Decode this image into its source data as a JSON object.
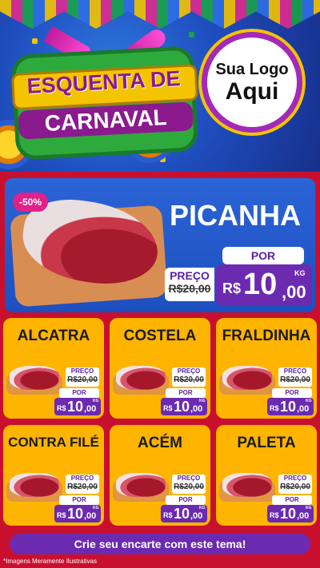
{
  "header": {
    "title_line1": "ESQUENTA DE",
    "title_line2": "CARNAVAL",
    "logo_line1": "Sua Logo",
    "logo_line2": "Aqui"
  },
  "featured": {
    "discount": "-50%",
    "name": "PICANHA",
    "preco_label": "PREÇO",
    "old_price": "R$20,00",
    "por_label": "POR",
    "currency": "R$",
    "price_int": "10",
    "price_cents": ",00",
    "unit": "KG"
  },
  "products": [
    {
      "name": "ALCATRA",
      "preco_label": "PREÇO",
      "old_price": "R$20,00",
      "por_label": "POR",
      "currency": "R$",
      "price_int": "10",
      "price_cents": ",00",
      "unit": "KG"
    },
    {
      "name": "COSTELA",
      "preco_label": "PREÇO",
      "old_price": "R$20,00",
      "por_label": "POR",
      "currency": "R$",
      "price_int": "10",
      "price_cents": ",00",
      "unit": "KG"
    },
    {
      "name": "FRALDINHA",
      "preco_label": "PREÇO",
      "old_price": "R$20,00",
      "por_label": "POR",
      "currency": "R$",
      "price_int": "10",
      "price_cents": ",00",
      "unit": "KG"
    },
    {
      "name": "CONTRA FILÉ",
      "preco_label": "PREÇO",
      "old_price": "R$20,00",
      "por_label": "POR",
      "currency": "R$",
      "price_int": "10",
      "price_cents": ",00",
      "unit": "KG"
    },
    {
      "name": "ACÉM",
      "preco_label": "PREÇO",
      "old_price": "R$20,00",
      "por_label": "POR",
      "currency": "R$",
      "price_int": "10",
      "price_cents": ",00",
      "unit": "KG"
    },
    {
      "name": "PALETA",
      "preco_label": "PREÇO",
      "old_price": "R$20,00",
      "por_label": "POR",
      "currency": "R$",
      "price_int": "10",
      "price_cents": ",00",
      "unit": "KG"
    }
  ],
  "footer": {
    "cta": "Crie seu encarte com este tema!",
    "disclaimer": "*Imagens Meramente Ilustrativas"
  },
  "colors": {
    "background_red": "#c8102e",
    "header_blue": "#1f4fc0",
    "card_yellow": "#ffb400",
    "price_purple": "#6b2ab0",
    "discount_pink": "#e0218a"
  }
}
